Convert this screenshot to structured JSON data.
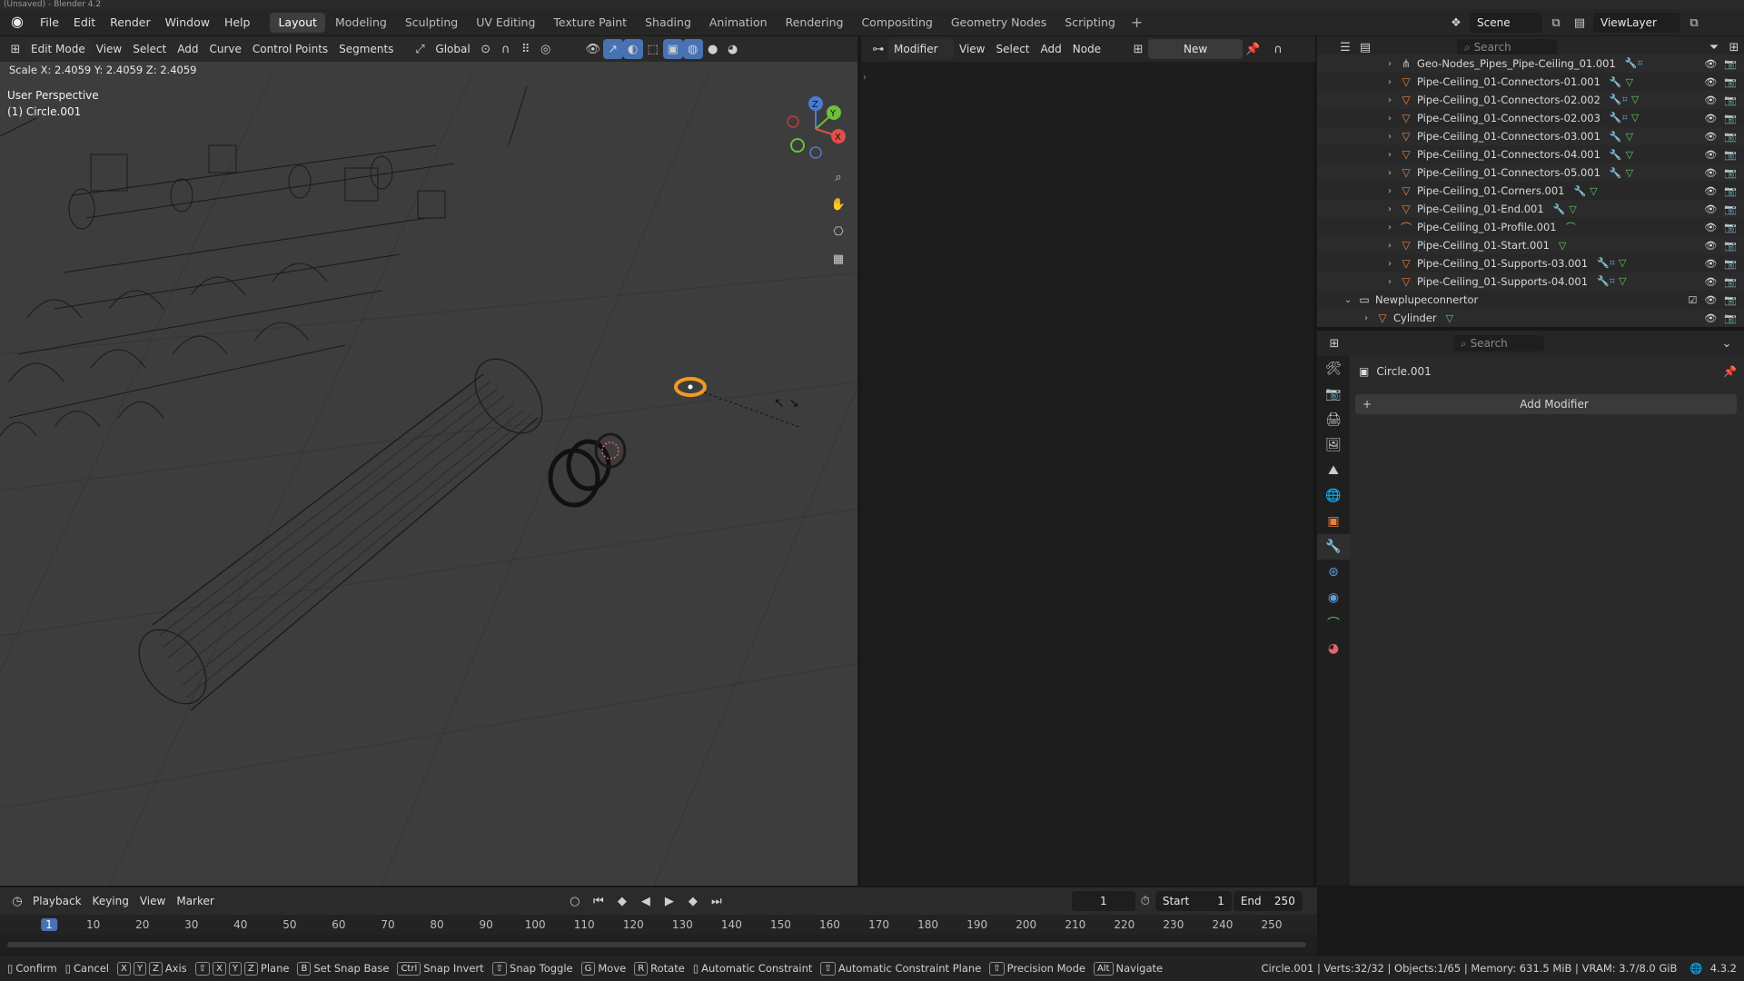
{
  "window": {
    "title": "(Unsaved) - Blender 4.2"
  },
  "topbar": {
    "menus": [
      "File",
      "Edit",
      "Render",
      "Window",
      "Help"
    ],
    "workspaces": [
      "Layout",
      "Modeling",
      "Sculpting",
      "UV Editing",
      "Texture Paint",
      "Shading",
      "Animation",
      "Rendering",
      "Compositing",
      "Geometry Nodes",
      "Scripting"
    ],
    "active_workspace": "Layout",
    "scene": "Scene",
    "view_layer": "ViewLayer"
  },
  "viewport": {
    "mode": "Edit Mode",
    "menus": [
      "View",
      "Select",
      "Add",
      "Curve",
      "Control Points",
      "Segments"
    ],
    "orientation": "Global",
    "transform_status": "Scale X: 2.4059   Y: 2.4059   Z: 2.4059",
    "perspective": "User Perspective",
    "object_label": "(1) Circle.001",
    "gizmo_axes": {
      "x": "X",
      "y": "Y",
      "z": "Z"
    }
  },
  "node_editor": {
    "type": "Modifier",
    "menus": [
      "View",
      "Select",
      "Add",
      "Node"
    ],
    "new_label": "New"
  },
  "outliner": {
    "search_placeholder": "Search",
    "rows": [
      {
        "name": "Geo-Nodes_Pipes_Pipe-Ceiling_01.001",
        "icon": "curve",
        "indent": 1
      },
      {
        "name": "Pipe-Ceiling_01-Connectors-01.001",
        "icon": "mesh",
        "indent": 1
      },
      {
        "name": "Pipe-Ceiling_01-Connectors-02.002",
        "icon": "mesh",
        "indent": 1
      },
      {
        "name": "Pipe-Ceiling_01-Connectors-02.003",
        "icon": "mesh",
        "indent": 1
      },
      {
        "name": "Pipe-Ceiling_01-Connectors-03.001",
        "icon": "mesh",
        "indent": 1
      },
      {
        "name": "Pipe-Ceiling_01-Connectors-04.001",
        "icon": "mesh",
        "indent": 1
      },
      {
        "name": "Pipe-Ceiling_01-Connectors-05.001",
        "icon": "mesh",
        "indent": 1
      },
      {
        "name": "Pipe-Ceiling_01-Corners.001",
        "icon": "mesh",
        "indent": 1
      },
      {
        "name": "Pipe-Ceiling_01-End.001",
        "icon": "mesh",
        "indent": 1
      },
      {
        "name": "Pipe-Ceiling_01-Profile.001",
        "icon": "curve",
        "indent": 1
      },
      {
        "name": "Pipe-Ceiling_01-Start.001",
        "icon": "mesh",
        "indent": 1
      },
      {
        "name": "Pipe-Ceiling_01-Supports-03.001",
        "icon": "mesh",
        "indent": 1
      },
      {
        "name": "Pipe-Ceiling_01-Supports-04.001",
        "icon": "mesh",
        "indent": 1
      },
      {
        "name": "Newplupeconnertor",
        "icon": "collection",
        "indent": 0
      },
      {
        "name": "Cylinder",
        "icon": "mesh",
        "indent": 1
      }
    ]
  },
  "properties": {
    "search_placeholder": "Search",
    "object_name": "Circle.001",
    "add_modifier_label": "Add Modifier"
  },
  "timeline": {
    "menus": [
      "Playback",
      "Keying",
      "View",
      "Marker"
    ],
    "current_frame": "1",
    "start_label": "Start",
    "start_value": "1",
    "end_label": "End",
    "end_value": "250",
    "ticks": [
      "1",
      "10",
      "20",
      "30",
      "40",
      "50",
      "60",
      "70",
      "80",
      "90",
      "100",
      "110",
      "120",
      "130",
      "140",
      "150",
      "160",
      "170",
      "180",
      "190",
      "200",
      "210",
      "220",
      "230",
      "240",
      "250"
    ]
  },
  "statusbar": {
    "items": [
      {
        "key": "",
        "label": "Confirm"
      },
      {
        "key": "",
        "label": "Cancel"
      },
      {
        "key": "X Y Z",
        "label": "Axis"
      },
      {
        "key": "⇧ X Y Z",
        "label": "Plane"
      },
      {
        "key": "B",
        "label": "Set Snap Base"
      },
      {
        "key": "Ctrl",
        "label": "Snap Invert"
      },
      {
        "key": "⇧",
        "label": "Snap Toggle"
      },
      {
        "key": "G",
        "label": "Move"
      },
      {
        "key": "R",
        "label": "Rotate"
      },
      {
        "key": "",
        "label": "Automatic Constraint"
      },
      {
        "key": "⇧",
        "label": "Automatic Constraint Plane"
      },
      {
        "key": "⇧",
        "label": "Precision Mode"
      },
      {
        "key": "Alt",
        "label": "Navigate"
      }
    ],
    "info": "Circle.001 | Verts:32/32 | Objects:1/65 | Memory: 631.5 MiB | VRAM: 3.7/8.0 GiB",
    "version": "4.3.2"
  },
  "colors": {
    "accent": "#e9803b",
    "active_blue": "#4772b3",
    "green": "#5ccc5c"
  }
}
